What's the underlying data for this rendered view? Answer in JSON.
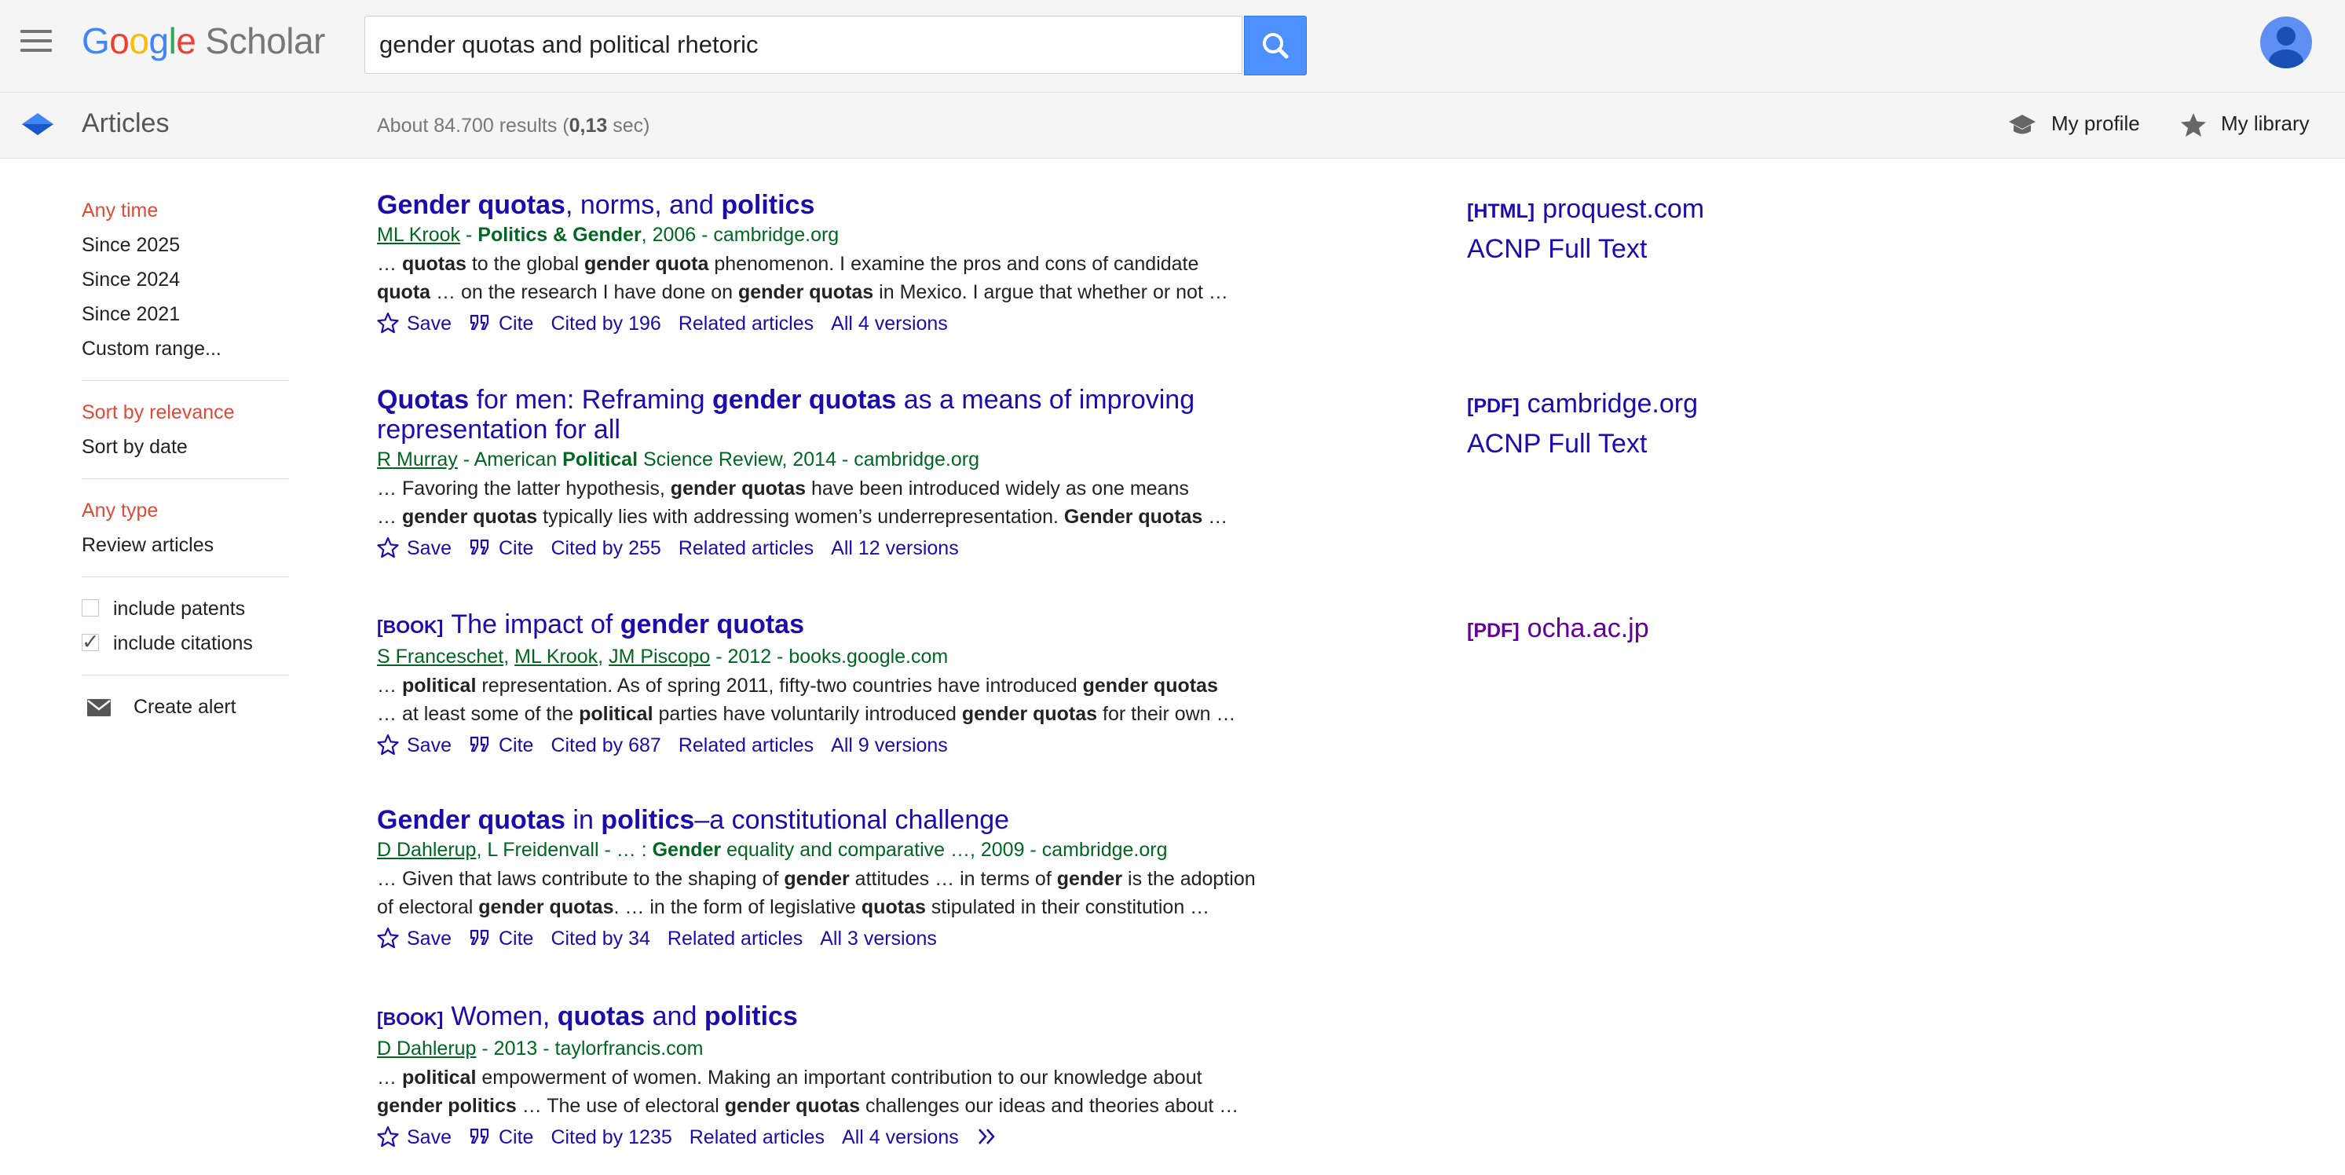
{
  "header": {
    "logo_google": [
      "G",
      "o",
      "o",
      "g",
      "l",
      "e"
    ],
    "logo_scholar": "Scholar",
    "search_value": "gender quotas and political rhetoric",
    "menu_icon": "menu-icon",
    "search_icon": "search-icon",
    "avatar_icon": "person-icon"
  },
  "subbar": {
    "section": "Articles",
    "results_prefix": "About 84.700 results (",
    "results_time": "0,13",
    "results_suffix": " sec)",
    "my_profile": "My profile",
    "my_library": "My library"
  },
  "sidebar": {
    "time": [
      "Any time",
      "Since 2025",
      "Since 2024",
      "Since 2021",
      "Custom range..."
    ],
    "sort": [
      "Sort by relevance",
      "Sort by date"
    ],
    "type": [
      "Any type",
      "Review articles"
    ],
    "include_patents": "include patents",
    "include_citations": "include citations",
    "create_alert": "Create alert"
  },
  "results": [
    {
      "tag": "",
      "title_html": "<b>Gender quotas</b>, norms, and <b>politics</b>",
      "authors_html": "<span class=\"au\">ML Krook</span> - <b>Politics &amp; Gender</b>, 2006 - cambridge.org",
      "snippet_html": "… <b>quotas</b> to the global <b>gender quota</b> phenomenon. I examine the pros and cons of candidate<br><b>quota</b> … on the research I have done on <b>gender quotas</b> in Mexico. I argue that whether or not …",
      "save": "Save",
      "cite": "Cite",
      "cited_by": "Cited by 196",
      "related": "Related articles",
      "versions": "All 4 versions",
      "side_tag": "[HTML]",
      "side_link": "proquest.com",
      "side_extra": "ACNP Full Text"
    },
    {
      "tag": "",
      "title_html": "<b>Quotas</b> for men: Reframing <b>gender quotas</b> as a means of improving<br>representation for all",
      "authors_html": "<span class=\"au\">R Murray</span> - American <b>Political</b> Science Review, 2014 - cambridge.org",
      "snippet_html": "… Favoring the latter hypothesis, <b>gender quotas</b> have been introduced widely as one means<br>… <b>gender quotas</b> typically lies with addressing women’s underrepresentation. <b>Gender quotas</b> …",
      "save": "Save",
      "cite": "Cite",
      "cited_by": "Cited by 255",
      "related": "Related articles",
      "versions": "All 12 versions",
      "side_tag": "[PDF]",
      "side_link": "cambridge.org",
      "side_extra": "ACNP Full Text"
    },
    {
      "tag": "[BOOK]",
      "title_html": "The impact of <b>gender quotas</b>",
      "authors_html": "<span class=\"au\">S Franceschet</span>, <span class=\"au\">ML Krook</span>, <span class=\"au\">JM Piscopo</span> - 2012 - books.google.com",
      "snippet_html": "… <b>political</b> representation. As of spring 2011, fifty-two countries have introduced <b>gender quotas</b><br>… at least some of the <b>political</b> parties have voluntarily introduced <b>gender quotas</b> for their own …",
      "save": "Save",
      "cite": "Cite",
      "cited_by": "Cited by 687",
      "related": "Related articles",
      "versions": "All 9 versions",
      "side_tag": "[PDF]",
      "side_link": "ocha.ac.jp",
      "side_extra": ""
    },
    {
      "tag": "",
      "title_html": "<b>Gender quotas</b> in <b>politics</b>–a constitutional challenge",
      "authors_html": "<span class=\"au\">D Dahlerup</span>, L Freidenvall - … : <b>Gender</b> equality and comparative …, 2009 - cambridge.org",
      "snippet_html": "… Given that laws contribute to the shaping of <b>gender</b> attitudes … in terms of <b>gender</b> is the adoption<br>of electoral <b>gender quotas</b>. … in the form of legislative <b>quotas</b> stipulated in their constitution …",
      "save": "Save",
      "cite": "Cite",
      "cited_by": "Cited by 34",
      "related": "Related articles",
      "versions": "All 3 versions",
      "side_tag": "",
      "side_link": "",
      "side_extra": ""
    },
    {
      "tag": "[BOOK]",
      "title_html": "Women, <b>quotas</b> and <b>politics</b>",
      "authors_html": "<span class=\"au\">D Dahlerup</span> - 2013 - taylorfrancis.com",
      "snippet_html": "… <b>political</b> empowerment of women. Making an important contribution to our knowledge about<br><b>gender politics</b> … The use of electoral <b>gender quotas</b> challenges our ideas and theories about …",
      "save": "Save",
      "cite": "Cite",
      "cited_by": "Cited by 1235",
      "related": "Related articles",
      "versions": "All 4 versions",
      "side_tag": "",
      "side_link": "",
      "side_extra": ""
    }
  ]
}
